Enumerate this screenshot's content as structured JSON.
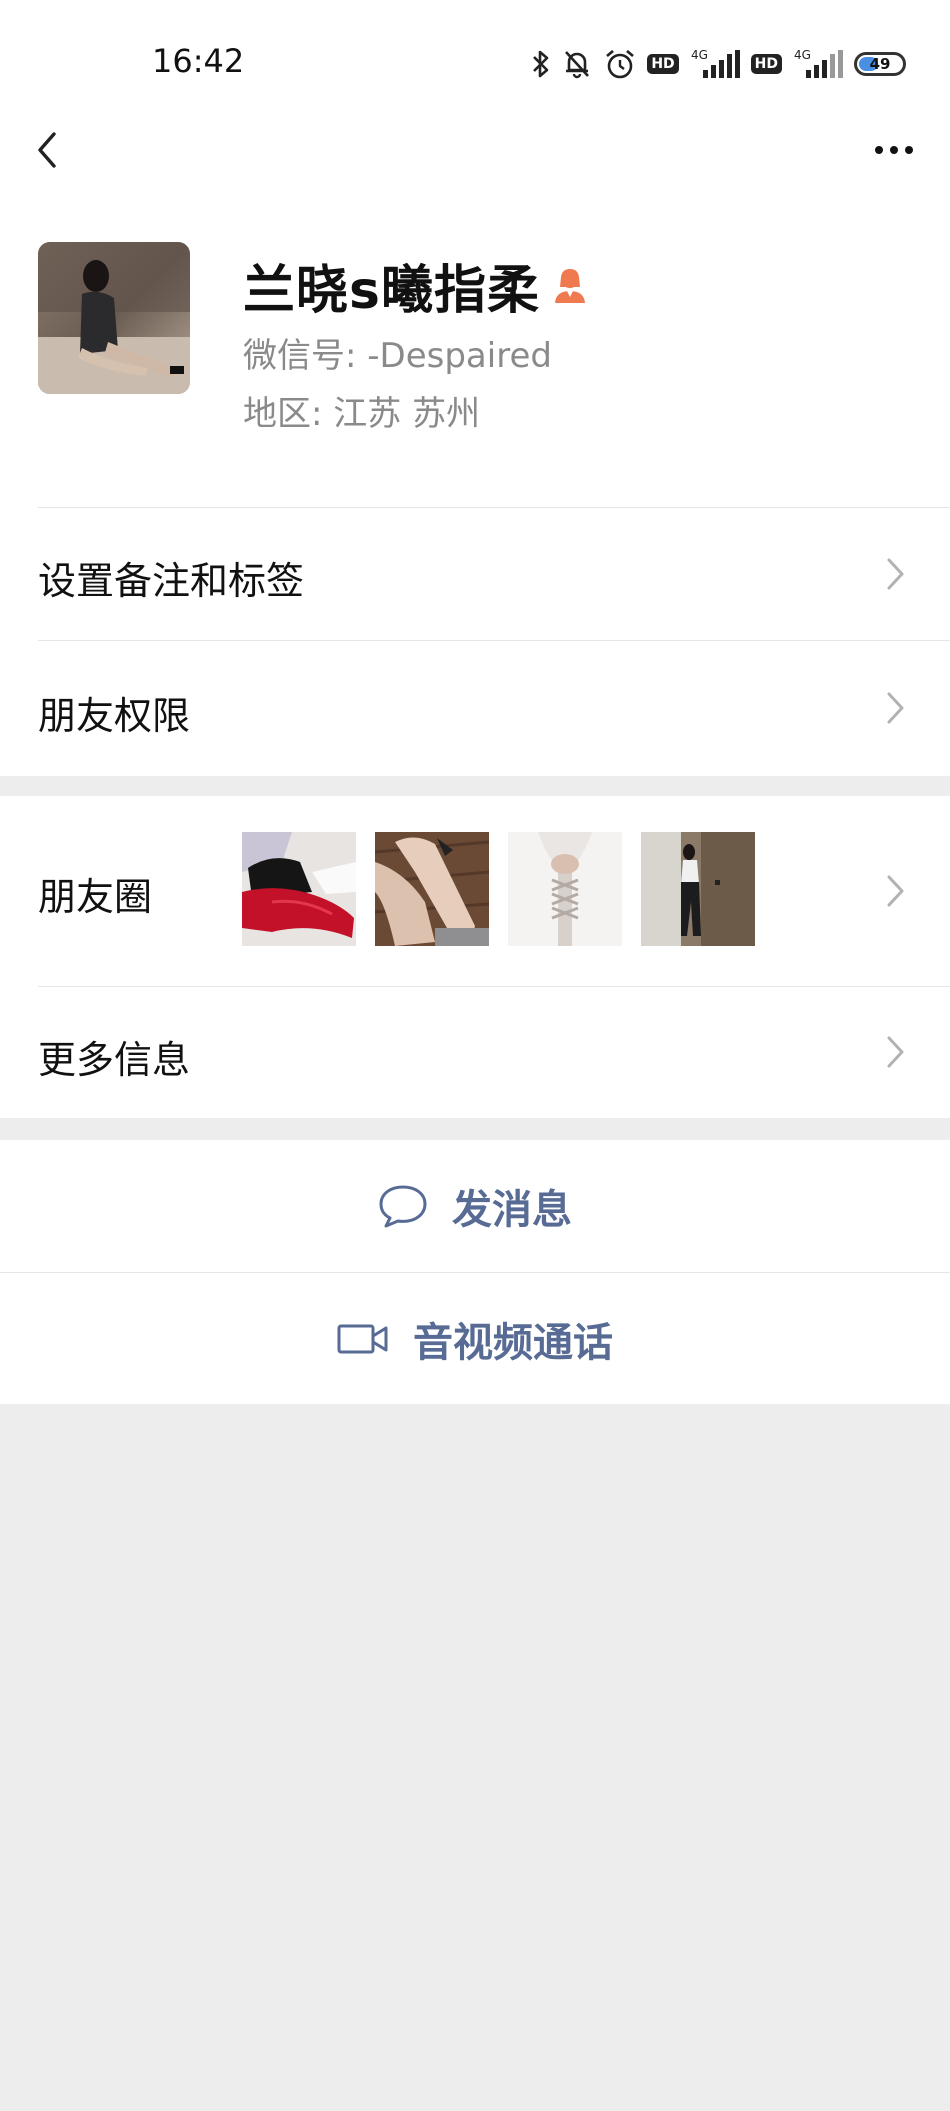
{
  "status_bar": {
    "time": "16:42",
    "hd1": "HD",
    "hd2": "HD",
    "net1": "4G",
    "net2": "4G",
    "battery_level": "49",
    "battery_percent": 49
  },
  "icons": {
    "back": "back-arrow-icon",
    "more": "more-dots-icon",
    "gender": "female-person-icon",
    "chat": "chat-bubble-icon",
    "video": "video-camera-icon",
    "chevron": "chevron-right-icon"
  },
  "colors": {
    "link_blue": "#576b95",
    "gender_orange": "#f07a50",
    "battery_blue": "#4a90e2"
  },
  "profile": {
    "name": "兰晓s曦指柔",
    "wechat_id": "微信号:  -Despaired",
    "region": "地区:  江苏  苏州"
  },
  "menu": {
    "remark_tags": "设置备注和标签",
    "friend_permissions": "朋友权限",
    "moments": "朋友圈",
    "more_info": "更多信息"
  },
  "actions": {
    "send_message": "发消息",
    "video_call": "音视频通话"
  }
}
